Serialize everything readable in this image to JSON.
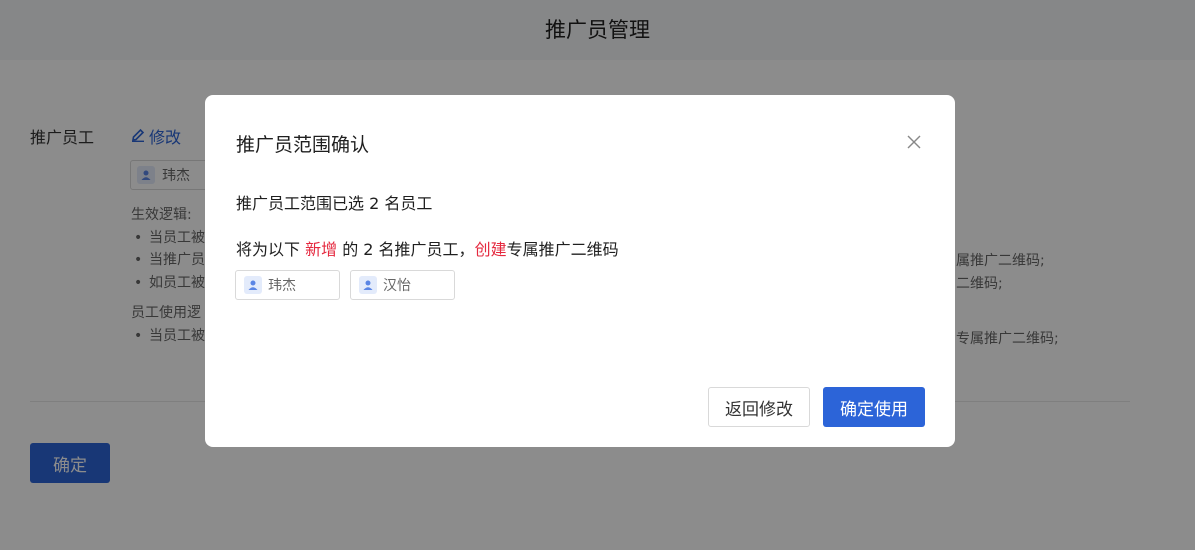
{
  "header": {
    "title": "推广员管理"
  },
  "main": {
    "field_label": "推广员工",
    "edit_label": "修改",
    "selected_chip": "玮杰",
    "rules": {
      "title1": "生效逻辑:",
      "items1": [
        "当员工被",
        "当推广员",
        "如员工被"
      ],
      "title2": "员工使用逻",
      "items2": [
        "当员工被"
      ]
    },
    "right_fragments": [
      "属推广二维码;",
      "二维码;",
      "专属推广二维码;"
    ],
    "confirm_label": "确定"
  },
  "modal": {
    "title": "推广员范围确认",
    "summary": "推广员工范围已选 2 名员工",
    "line2": {
      "pre": "将为以下 ",
      "highlight1": "新增",
      "mid": " 的 2 名推广员工，",
      "highlight2": "创建",
      "post": "专属推广二维码"
    },
    "employees": [
      "玮杰",
      "汉怡"
    ],
    "back_label": "返回修改",
    "confirm_label": "确定使用"
  },
  "colors": {
    "primary": "#2c64d8",
    "highlight": "#e5293f"
  }
}
